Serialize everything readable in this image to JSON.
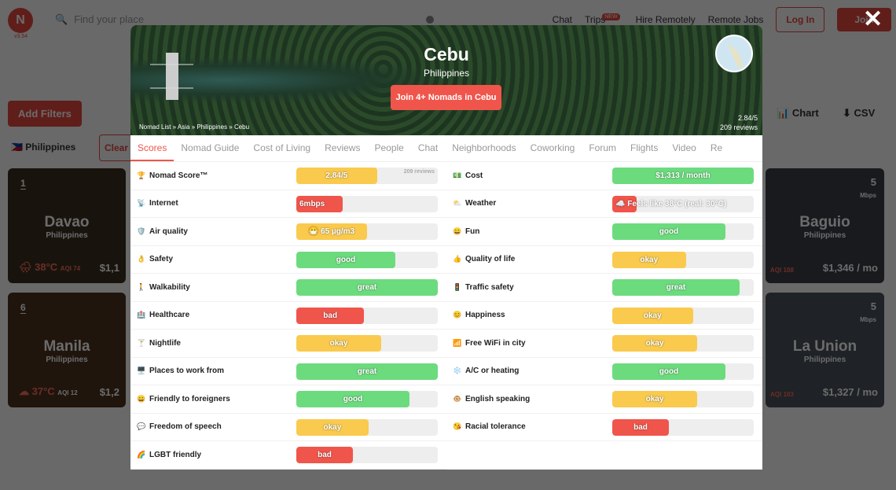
{
  "colors": {
    "great": "#6cdb7e",
    "good": "#6cdb7e",
    "okay": "#f9ca4d",
    "bad": "#f0554b",
    "accent": "#f0554b"
  },
  "topbar": {
    "logo_version": "v3.54",
    "search_placeholder": "Find your place",
    "nav": [
      "Chat",
      "Trips",
      "Hire Remotely",
      "Remote Jobs"
    ],
    "trips_badge": "NEW",
    "login": "Log In",
    "join": "Join"
  },
  "filters": {
    "add": "Add Filters",
    "chip": "Philippines",
    "clear": "Clear",
    "chart": "Chart",
    "csv": "CSV"
  },
  "cards": [
    {
      "rank": "1",
      "name": "Davao",
      "country": "Philippines",
      "temp": "38°C",
      "aqi": "AQI 74",
      "price": "$1,1"
    },
    {
      "rank": "6",
      "name": "Manila",
      "country": "Philippines",
      "temp": "37°C",
      "aqi": "AQI 12",
      "price": "$1,2"
    },
    {
      "name": "Baguio",
      "country": "Philippines",
      "speed": "5",
      "speed_unit": "Mbps",
      "aqi": "AQI 108",
      "price": "$1,346 / mo"
    },
    {
      "name": "La Union",
      "country": "Philippines",
      "speed": "5",
      "speed_unit": "Mbps",
      "aqi": "AQI 103",
      "price": "$1,327 / mo"
    }
  ],
  "modal": {
    "city": "Cebu",
    "country": "Philippines",
    "join": "Join 4+ Nomads in Cebu",
    "breadcrumb": "Nomad List » Asia » Philippines » Cebu",
    "score": "2.84/5",
    "reviews": "209 reviews",
    "tabs": [
      "Scores",
      "Nomad Guide",
      "Cost of Living",
      "Reviews",
      "People",
      "Chat",
      "Neighborhoods",
      "Coworking",
      "Forum",
      "Flights",
      "Video",
      "Re"
    ],
    "active_tab": "Scores",
    "left": [
      {
        "icon": "🏆",
        "label": "Nomad Score™",
        "value": "2.84/5",
        "level": "okay",
        "pct": 57,
        "extra": "209 reviews"
      },
      {
        "icon": "📡",
        "label": "Internet",
        "value": "6mbps",
        "level": "bad",
        "pct": 33
      },
      {
        "icon": "🛡️",
        "label": "Air quality",
        "value": "😷 65 µg/m3",
        "level": "okay",
        "pct": 50
      },
      {
        "icon": "👌",
        "label": "Safety",
        "value": "good",
        "level": "good",
        "pct": 70
      },
      {
        "icon": "🚶",
        "label": "Walkability",
        "value": "great",
        "level": "great",
        "pct": 100
      },
      {
        "icon": "🏥",
        "label": "Healthcare",
        "value": "bad",
        "level": "bad",
        "pct": 48
      },
      {
        "icon": "🍸",
        "label": "Nightlife",
        "value": "okay",
        "level": "okay",
        "pct": 60
      },
      {
        "icon": "🖥️",
        "label": "Places to work from",
        "value": "great",
        "level": "great",
        "pct": 100
      },
      {
        "icon": "😀",
        "label": "Friendly to foreigners",
        "value": "good",
        "level": "good",
        "pct": 80
      },
      {
        "icon": "💬",
        "label": "Freedom of speech",
        "value": "okay",
        "level": "okay",
        "pct": 51
      },
      {
        "icon": "🌈",
        "label": "LGBT friendly",
        "value": "bad",
        "level": "bad",
        "pct": 40
      }
    ],
    "right": [
      {
        "icon": "💵",
        "label": "Cost",
        "value": "$1,313 / month",
        "level": "good",
        "pct": 100
      },
      {
        "icon": "⛅",
        "label": "Weather",
        "value": "☁️ Feels like 38°C (real: 30°C)",
        "level": "bad",
        "pct": 17
      },
      {
        "icon": "😀",
        "label": "Fun",
        "value": "good",
        "level": "good",
        "pct": 80
      },
      {
        "icon": "👍",
        "label": "Quality of life",
        "value": "okay",
        "level": "okay",
        "pct": 52
      },
      {
        "icon": "🚦",
        "label": "Traffic safety",
        "value": "great",
        "level": "great",
        "pct": 90
      },
      {
        "icon": "😊",
        "label": "Happiness",
        "value": "okay",
        "level": "okay",
        "pct": 57
      },
      {
        "icon": "📶",
        "label": "Free WiFi in city",
        "value": "okay",
        "level": "okay",
        "pct": 60
      },
      {
        "icon": "❄️",
        "label": "A/C or heating",
        "value": "good",
        "level": "good",
        "pct": 80
      },
      {
        "icon": "🐵",
        "label": "English speaking",
        "value": "okay",
        "level": "okay",
        "pct": 60
      },
      {
        "icon": "😘",
        "label": "Racial tolerance",
        "value": "bad",
        "level": "bad",
        "pct": 40
      }
    ]
  }
}
